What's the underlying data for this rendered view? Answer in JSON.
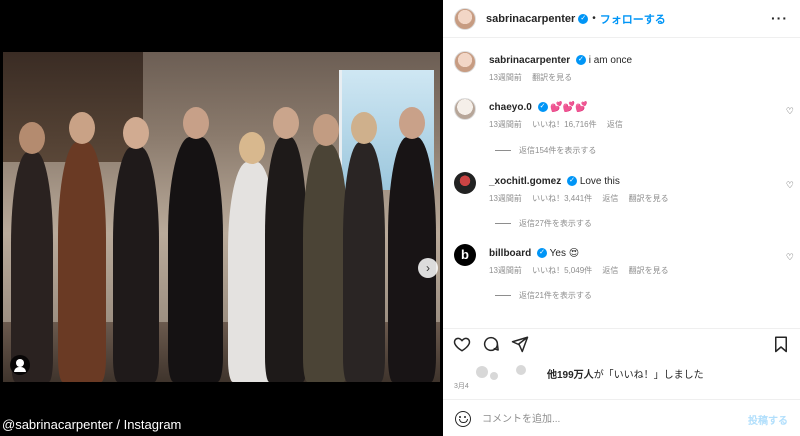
{
  "credit": "@sabrinacarpenter / Instagram",
  "header": {
    "username": "sabrinacarpenter",
    "separator": "•",
    "follow_label": "フォローする",
    "more_label": "···"
  },
  "caption": {
    "username": "sabrinacarpenter",
    "text": "i am once",
    "time": "13週間前",
    "translate": "翻訳を見る"
  },
  "comments": [
    {
      "username": "chaeyo.0",
      "text": "💕💕💕",
      "time": "13週間前",
      "likes": "いいね！16,716件",
      "reply": "返信",
      "replies_label": "返信154件を表示する"
    },
    {
      "username": "_xochitl.gomez",
      "text": "Love this",
      "time": "13週間前",
      "likes": "いいね！3,441件",
      "reply": "返信",
      "translate": "翻訳を見る",
      "replies_label": "返信27件を表示する"
    },
    {
      "username": "billboard",
      "text": "Yes 😍",
      "time": "13週間前",
      "likes": "いいね！5,049件",
      "reply": "返信",
      "translate": "翻訳を見る",
      "replies_label": "返信21件を表示する"
    }
  ],
  "likes_summary": {
    "count_text": "他199万人",
    "suffix": "が「いいね！」しました"
  },
  "date": "3月4",
  "comment_box": {
    "placeholder": "コメントを追加...",
    "post_label": "投稿する"
  },
  "carousel": {
    "current_index": 1,
    "total": 4
  },
  "colors": {
    "accent": "#0095f6",
    "muted": "#8e8e8e",
    "text": "#262626"
  }
}
